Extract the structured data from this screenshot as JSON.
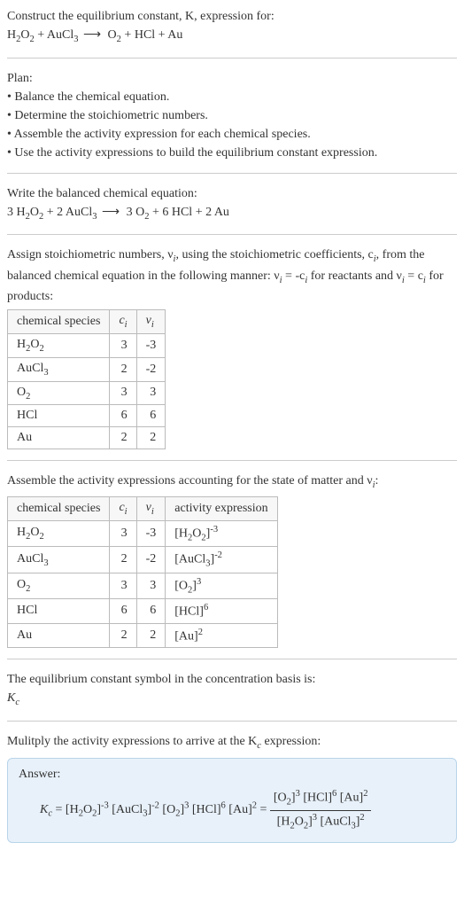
{
  "prompt": {
    "line1": "Construct the equilibrium constant, K, expression for:",
    "equation_lhs1": "H",
    "equation_lhs1_sub": "2",
    "equation_lhs1b": "O",
    "equation_lhs1b_sub": "2",
    "plus1": " + ",
    "equation_lhs2": "AuCl",
    "equation_lhs2_sub": "3",
    "arrow": " ⟶ ",
    "equation_rhs1": "O",
    "equation_rhs1_sub": "2",
    "plus2": " + ",
    "equation_rhs2": "HCl",
    "plus3": " + ",
    "equation_rhs3": "Au"
  },
  "plan": {
    "title": "Plan:",
    "b1": "• Balance the chemical equation.",
    "b2": "• Determine the stoichiometric numbers.",
    "b3": "• Assemble the activity expression for each chemical species.",
    "b4": "• Use the activity expressions to build the equilibrium constant expression."
  },
  "balanced": {
    "title": "Write the balanced chemical equation:",
    "c1": "3 H",
    "c1s": "2",
    "c1b": "O",
    "c1bs": "2",
    "p1": " + ",
    "c2": "2 AuCl",
    "c2s": "3",
    "arrow": " ⟶ ",
    "c3": "3 O",
    "c3s": "2",
    "p2": " + ",
    "c4": "6 HCl",
    "p3": " + ",
    "c5": "2 Au"
  },
  "assign": {
    "text1": "Assign stoichiometric numbers, ν",
    "text1s": "i",
    "text2": ", using the stoichiometric coefficients, c",
    "text2s": "i",
    "text3": ", from the balanced chemical equation in the following manner: ν",
    "text3s": "i",
    "text4": " = -c",
    "text4s": "i",
    "text5": " for reactants and ν",
    "text5s": "i",
    "text6": " = c",
    "text6s": "i",
    "text7": " for products:"
  },
  "table1": {
    "h1": "chemical species",
    "h2": "c",
    "h2s": "i",
    "h3": "ν",
    "h3s": "i",
    "r1c1a": "H",
    "r1c1as": "2",
    "r1c1b": "O",
    "r1c1bs": "2",
    "r1c2": "3",
    "r1c3": "-3",
    "r2c1": "AuCl",
    "r2c1s": "3",
    "r2c2": "2",
    "r2c3": "-2",
    "r3c1": "O",
    "r3c1s": "2",
    "r3c2": "3",
    "r3c3": "3",
    "r4c1": "HCl",
    "r4c2": "6",
    "r4c3": "6",
    "r5c1": "Au",
    "r5c2": "2",
    "r5c3": "2"
  },
  "assemble": {
    "t1": "Assemble the activity expressions accounting for the state of matter and ν",
    "t1s": "i",
    "t2": ":"
  },
  "table2": {
    "h1": "chemical species",
    "h2": "c",
    "h2s": "i",
    "h3": "ν",
    "h3s": "i",
    "h4": "activity expression",
    "r1c1a": "H",
    "r1c1as": "2",
    "r1c1b": "O",
    "r1c1bs": "2",
    "r1c2": "3",
    "r1c3": "-3",
    "r1e1": "[H",
    "r1e1s": "2",
    "r1e2": "O",
    "r1e2s": "2",
    "r1e3": "]",
    "r1e3sup": "-3",
    "r2c1": "AuCl",
    "r2c1s": "3",
    "r2c2": "2",
    "r2c3": "-2",
    "r2e1": "[AuCl",
    "r2e1s": "3",
    "r2e2": "]",
    "r2e2sup": "-2",
    "r3c1": "O",
    "r3c1s": "2",
    "r3c2": "3",
    "r3c3": "3",
    "r3e1": "[O",
    "r3e1s": "2",
    "r3e2": "]",
    "r3e2sup": "3",
    "r4c1": "HCl",
    "r4c2": "6",
    "r4c3": "6",
    "r4e1": "[HCl]",
    "r4e1sup": "6",
    "r5c1": "Au",
    "r5c2": "2",
    "r5c3": "2",
    "r5e1": "[Au]",
    "r5e1sup": "2"
  },
  "basis": {
    "t1": "The equilibrium constant symbol in the concentration basis is:",
    "sym": "K",
    "syms": "c"
  },
  "mult": {
    "t1": "Mulitply the activity expressions to arrive at the K",
    "t1s": "c",
    "t2": " expression:"
  },
  "answer": {
    "label": "Answer:",
    "lhs1": "K",
    "lhs1s": "c",
    "eq": " = ",
    "a1": "[H",
    "a1s": "2",
    "a2": "O",
    "a2s": "2",
    "a3": "]",
    "a3sup": "-3",
    "sp1": " ",
    "b1": "[AuCl",
    "b1s": "3",
    "b2": "]",
    "b2sup": "-2",
    "sp2": " ",
    "c1": "[O",
    "c1s": "2",
    "c2": "]",
    "c2sup": "3",
    "sp3": " ",
    "d1": "[HCl]",
    "d1sup": "6",
    "sp4": " ",
    "e1": "[Au]",
    "e1sup": "2",
    "eq2": " = ",
    "num_a1": "[O",
    "num_a1s": "2",
    "num_a2": "]",
    "num_a2sup": "3",
    "num_sp1": " ",
    "num_b1": "[HCl]",
    "num_b1sup": "6",
    "num_sp2": " ",
    "num_c1": "[Au]",
    "num_c1sup": "2",
    "den_a1": "[H",
    "den_a1s": "2",
    "den_a2": "O",
    "den_a2s": "2",
    "den_a3": "]",
    "den_a3sup": "3",
    "den_sp1": " ",
    "den_b1": "[AuCl",
    "den_b1s": "3",
    "den_b2": "]",
    "den_b2sup": "2"
  }
}
